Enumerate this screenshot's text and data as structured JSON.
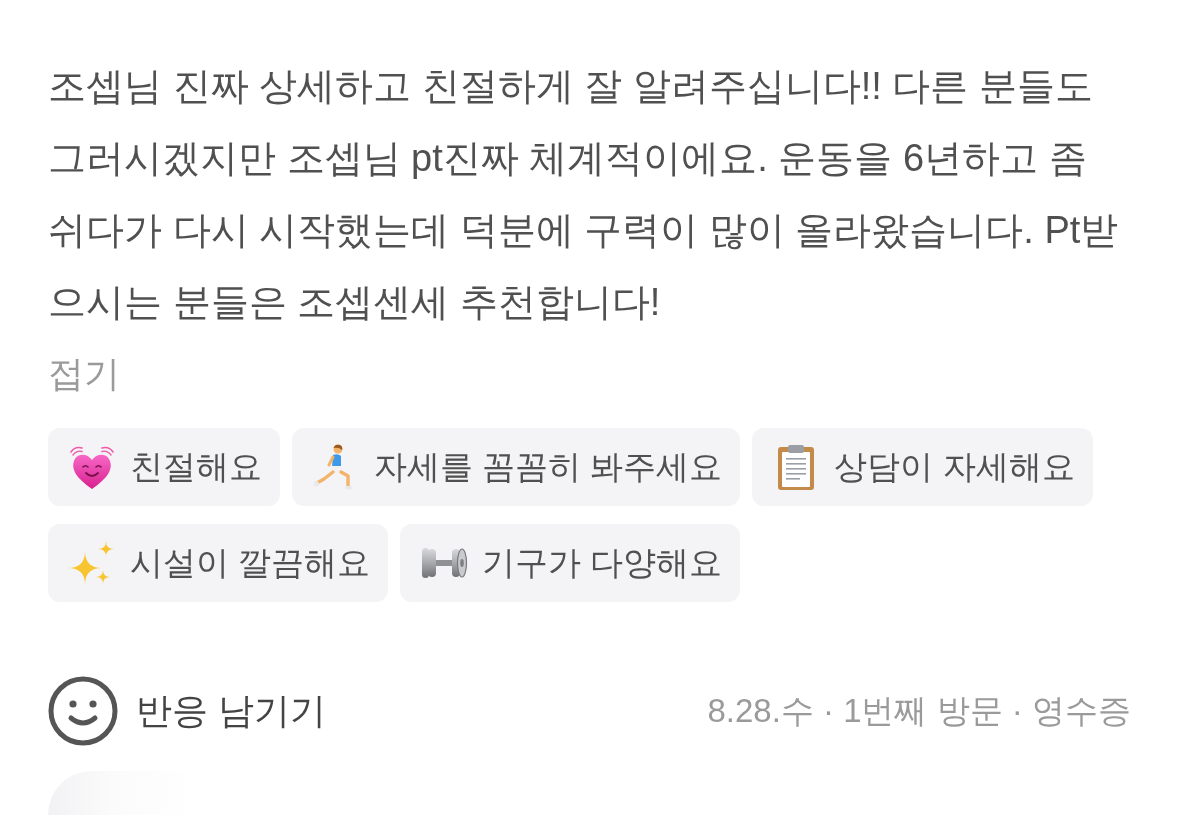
{
  "review": {
    "text": "조셉님 진짜 상세하고 친절하게 잘 알려주십니다!! 다른 분들도 그러시겠지만 조셉님 pt진짜 체계적이에요. 운동을 6년하고 좀 쉬다가 다시 시작했는데 덕분에 구력이 많이 올라왔습니다. Pt받으시는 분들은 조셉센세 추천합니다!",
    "fold_label": "접기"
  },
  "keywords": [
    "친절해요",
    "자세를 꼼꼼히 봐주세요",
    "상담이 자세해요",
    "시설이 깔끔해요",
    "기구가 다양해요"
  ],
  "footer": {
    "reaction_label": "반응 남기기",
    "visit_info": "8.28.수 · 1번째 방문 · 영수증"
  }
}
